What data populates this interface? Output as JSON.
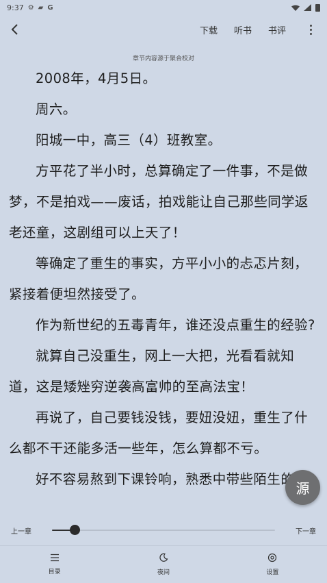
{
  "status": {
    "time": "9:37",
    "icons": [
      "settings-icon",
      "cat-icon",
      "google-icon"
    ],
    "right_icons": [
      "wifi-icon",
      "signal-icon",
      "battery-icon"
    ]
  },
  "toolbar": {
    "download_label": "下载",
    "listen_label": "听书",
    "review_label": "书评"
  },
  "source_note": "章节内容源于聚合校对",
  "content": {
    "paragraphs": [
      "2008年，4月5日。",
      "周六。",
      "阳城一中，高三（4）班教室。",
      "方平花了半小时，总算确定了一件事，不是做梦，不是拍戏——废话，拍戏能让自己那些同学返老还童，这剧组可以上天了！",
      "等确定了重生的事实，方平小小的忐忑片刻，紧接着便坦然接受了。",
      "作为新世纪的五毒青年，谁还没点重生的经验?",
      "就算自己没重生，网上一大把，光看看就知道，这是矮矬穷逆袭高富帅的至高法宝！",
      "再说了，自己要钱没钱，要妞没妞，重生了什么都不干还能多活一些年，怎么算都不亏。",
      "好不容易熬到下课铃响，熟悉中带些陌生的"
    ]
  },
  "fab": {
    "label": "源"
  },
  "chapter_nav": {
    "prev_label": "上一章",
    "next_label": "下一章",
    "progress": 0.1
  },
  "bottom_nav": {
    "toc_label": "目录",
    "night_label": "夜间",
    "settings_label": "设置"
  },
  "colors": {
    "background": "#cfd8e6",
    "text": "#1e1e1e",
    "fab": "#6e6f71"
  }
}
